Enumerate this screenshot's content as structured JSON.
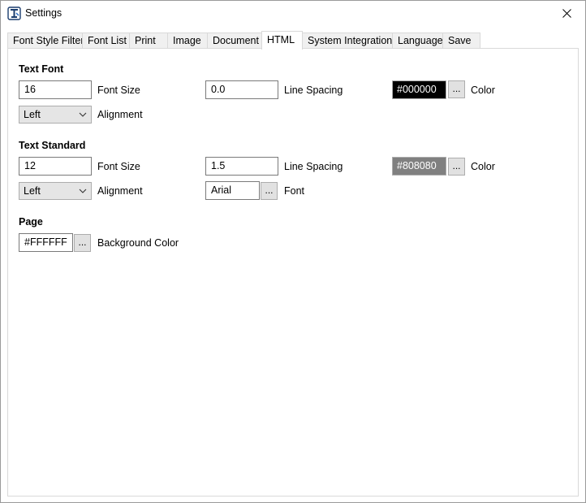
{
  "window": {
    "title": "Settings"
  },
  "tabs": [
    {
      "label": "Font Style Filter"
    },
    {
      "label": "Font List"
    },
    {
      "label": "Print"
    },
    {
      "label": "Image"
    },
    {
      "label": "Document"
    },
    {
      "label": "HTML"
    },
    {
      "label": "System Integration"
    },
    {
      "label": "Language"
    },
    {
      "label": "Save"
    }
  ],
  "active_tab": "HTML",
  "text_font": {
    "title": "Text Font",
    "font_size_value": "16",
    "font_size_label": "Font Size",
    "line_spacing_value": "0.0",
    "line_spacing_label": "Line Spacing",
    "color_value": "#000000",
    "color_label": "Color",
    "color_bg": "#000000",
    "color_fg": "#ffffff",
    "alignment_value": "Left",
    "alignment_label": "Alignment",
    "browse": "..."
  },
  "text_standard": {
    "title": "Text Standard",
    "font_size_value": "12",
    "font_size_label": "Font Size",
    "line_spacing_value": "1.5",
    "line_spacing_label": "Line Spacing",
    "color_value": "#808080",
    "color_label": "Color",
    "color_bg": "#808080",
    "color_fg": "#ffffff",
    "alignment_value": "Left",
    "alignment_label": "Alignment",
    "font_value": "Arial",
    "font_label": "Font",
    "browse": "..."
  },
  "page": {
    "title": "Page",
    "background_value": "#FFFFFF",
    "background_label": "Background Color",
    "browse": "..."
  }
}
